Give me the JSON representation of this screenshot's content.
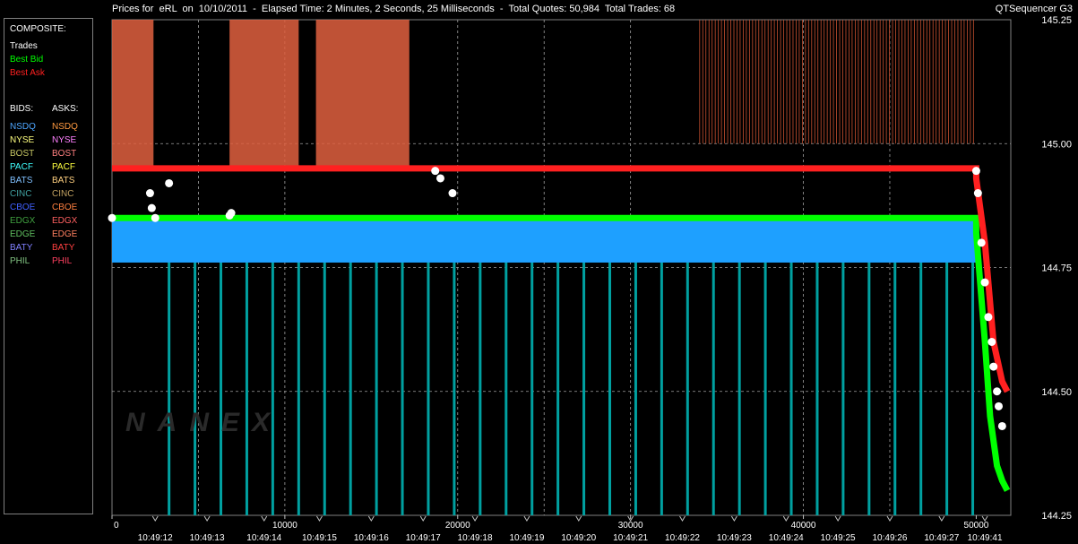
{
  "header": {
    "title": "Prices for  eRL  on  10/10/2011  -  Elapsed Time: 2 Minutes, 2 Seconds, 25 Milliseconds  -  Total Quotes: 50,984  Total Trades: 68",
    "app_name": "QTSequencer G3"
  },
  "watermark": "NANEX",
  "legend": {
    "composite_label": "COMPOSITE:",
    "composite": [
      {
        "label": "Trades",
        "color": "#ffffff"
      },
      {
        "label": "Best Bid",
        "color": "#00ff00"
      },
      {
        "label": "Best Ask",
        "color": "#ff2020"
      }
    ],
    "bids_label": "BIDS:",
    "asks_label": "ASKS:",
    "exchanges": [
      {
        "bid": "NSDQ",
        "ask": "NSDQ",
        "bid_color": "#4da6ff",
        "ask_color": "#ff9a40"
      },
      {
        "bid": "NYSE",
        "ask": "NYSE",
        "bid_color": "#ffff80",
        "ask_color": "#ff80ff"
      },
      {
        "bid": "BOST",
        "ask": "BOST",
        "bid_color": "#c8c864",
        "ask_color": "#ff8080"
      },
      {
        "bid": "PACF",
        "ask": "PACF",
        "bid_color": "#40ffff",
        "ask_color": "#ffff40"
      },
      {
        "bid": "BATS",
        "ask": "BATS",
        "bid_color": "#80c0ff",
        "ask_color": "#ffd080"
      },
      {
        "bid": "CINC",
        "ask": "CINC",
        "bid_color": "#40a0a0",
        "ask_color": "#c0a060"
      },
      {
        "bid": "CBOE",
        "ask": "CBOE",
        "bid_color": "#4060ff",
        "ask_color": "#ff8040"
      },
      {
        "bid": "EDGX",
        "ask": "EDGX",
        "bid_color": "#40a040",
        "ask_color": "#ff6060"
      },
      {
        "bid": "EDGE",
        "ask": "EDGE",
        "bid_color": "#60c060",
        "ask_color": "#ff8060"
      },
      {
        "bid": "BATY",
        "ask": "BATY",
        "bid_color": "#8080ff",
        "ask_color": "#ff4040"
      },
      {
        "bid": "PHIL",
        "ask": "PHIL",
        "bid_color": "#80c080",
        "ask_color": "#ff4060"
      }
    ]
  },
  "chart_data": {
    "type": "line",
    "title": "Prices for  eRL  on  10/10/2011",
    "xlim": [
      0,
      52000
    ],
    "ylim": [
      144.25,
      145.25
    ],
    "y_ticks": [
      144.25,
      144.5,
      144.75,
      145.0,
      145.25
    ],
    "y_tick_labels": [
      "144.25",
      "144.50",
      "144.75",
      "145.00",
      "145.25"
    ],
    "x_ticks": [
      0,
      10000,
      20000,
      30000,
      40000,
      50000
    ],
    "x_tick_labels": [
      "0",
      "10000",
      "20000",
      "30000",
      "40000",
      "50000"
    ],
    "time_labels": [
      "10:49:12",
      "10:49:13",
      "10:49:14",
      "10:49:15",
      "10:49:16",
      "10:49:17",
      "10:49:18",
      "10:49:19",
      "10:49:20",
      "10:49:21",
      "10:49:22",
      "10:49:23",
      "10:49:24",
      "10:49:25",
      "10:49:26",
      "10:49:27",
      "10:49:41"
    ],
    "time_label_x": [
      2500,
      5500,
      8800,
      12000,
      15000,
      18000,
      21000,
      24000,
      27000,
      30000,
      33000,
      36000,
      39000,
      42000,
      45000,
      48000,
      50500
    ],
    "grid": true,
    "series": [
      {
        "name": "Best Bid",
        "color": "#00ff00",
        "x": [
          0,
          50000,
          50000,
          50500,
          50800,
          51200,
          51500,
          51800
        ],
        "y": [
          144.85,
          144.85,
          144.82,
          144.6,
          144.45,
          144.35,
          144.32,
          144.3
        ]
      },
      {
        "name": "Best Ask",
        "color": "#ff2020",
        "x": [
          0,
          50000,
          50000,
          50500,
          51000,
          51500,
          51800
        ],
        "y": [
          144.95,
          144.95,
          144.93,
          144.8,
          144.6,
          144.52,
          144.5
        ]
      },
      {
        "name": "Trades",
        "color": "#ffffff",
        "x": [
          0,
          2200,
          2300,
          2500,
          3300,
          6800,
          6900,
          18700,
          19000,
          19700,
          50000,
          50100,
          50300,
          50500,
          50700,
          50900,
          51000,
          51200,
          51300,
          51500
        ],
        "y": [
          144.85,
          144.9,
          144.87,
          144.85,
          144.92,
          144.855,
          144.86,
          144.945,
          144.93,
          144.9,
          144.945,
          144.9,
          144.8,
          144.72,
          144.65,
          144.6,
          144.55,
          144.5,
          144.47,
          144.43
        ]
      }
    ]
  }
}
